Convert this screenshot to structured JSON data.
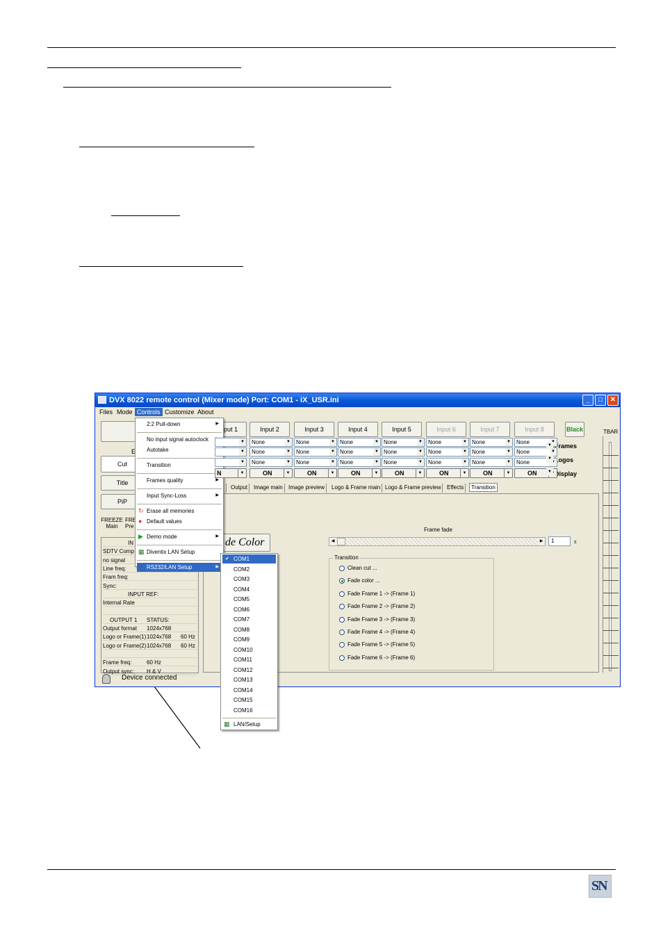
{
  "window": {
    "title": "DVX 8022 remote control     (Mixer mode)  Port: COM1 - iX_USR.ini"
  },
  "menubar": [
    "Files",
    "Mode",
    "Controls",
    "Customize",
    "About"
  ],
  "left_buttons": {
    "letter": "E",
    "cut": "Cut",
    "title": "Title",
    "pip": "PiP",
    "freeze1": "FREEZE",
    "freeze1_sub": "Main",
    "freeze2": "FRE",
    "freeze2_sub": "Pre"
  },
  "inputs": [
    {
      "label": "Input 1",
      "enabled": true
    },
    {
      "label": "Input 2",
      "enabled": true
    },
    {
      "label": "Input 3",
      "enabled": true
    },
    {
      "label": "Input 4",
      "enabled": true
    },
    {
      "label": "Input 5",
      "enabled": true
    },
    {
      "label": "Input 6",
      "enabled": false
    },
    {
      "label": "Input 7",
      "enabled": false
    },
    {
      "label": "Input 8",
      "enabled": false
    }
  ],
  "combo_value": "None",
  "on_label": "ON",
  "partial_labels": {
    "input1": "put 1",
    "on1": "N"
  },
  "black_button": "Black",
  "row_labels": [
    ":Frames",
    ":Logos",
    ":Display"
  ],
  "tbar_label": "TBAR",
  "tabs": [
    "Output",
    "Image main",
    "Image preview",
    "Logo & Frame main",
    "Logo & Frame preview",
    "Effects",
    "Transition"
  ],
  "fade_color_button": "de Color",
  "frame_fade": {
    "label": "Frame fade",
    "value": "1",
    "unit": "s"
  },
  "transition_group": {
    "title": "Transition",
    "options": [
      "Clean cut ...",
      "Fade color ...",
      "Fade Frame 1 -> (Frame 1)",
      "Fade Frame 2 -> (Frame 2)",
      "Fade Frame 3 -> (Frame 3)",
      "Fade Frame 4 -> (Frame 4)",
      "Fade Frame 5 -> (Frame 5)",
      "Fade Frame 6 -> (Frame 6)"
    ],
    "selected": 1
  },
  "status": {
    "rows": [
      {
        "a": "IN",
        "b": ""
      },
      {
        "a": "SDTV Comp",
        "b": ""
      },
      {
        "a": "no signal",
        "b": ""
      },
      {
        "a": "Line freq:",
        "b": ""
      },
      {
        "a": "Fram freq:",
        "b": ""
      },
      {
        "a": "Sync:",
        "b": ""
      },
      {
        "a": "INPUT REF:",
        "b": ""
      },
      {
        "a": "Internal Rate",
        "b": ""
      },
      {
        "a": "",
        "b": ""
      },
      {
        "a": "OUTPUT 1",
        "b": "STATUS:"
      },
      {
        "a": "Output format",
        "b": "1024x768"
      },
      {
        "a": "Logo or Frame(1)",
        "b": "1024x768",
        "c": "60 Hz"
      },
      {
        "a": "Logo or Frame(2)",
        "b": "1024x768",
        "c": "60 Hz"
      },
      {
        "a": "",
        "b": ""
      },
      {
        "a": "Frame freq:",
        "b": "60 Hz"
      },
      {
        "a": "Output sync:",
        "b": "H & V"
      }
    ],
    "connection": "Device connected"
  },
  "controls_menu": [
    {
      "label": "2:2 Pull-down",
      "sub": true
    },
    {
      "sep": true
    },
    {
      "label": "No input signal autoclock",
      "sub": true
    },
    {
      "label": "Autotake",
      "sub": true
    },
    {
      "sep": true
    },
    {
      "label": "Transition",
      "sub": true
    },
    {
      "sep": true
    },
    {
      "label": "Frames quality",
      "sub": true
    },
    {
      "sep": true
    },
    {
      "label": "Input Sync-Loss",
      "sub": true
    },
    {
      "sep": true
    },
    {
      "label": "Erase all memories",
      "icon": "erase"
    },
    {
      "label": "Default values",
      "icon": "default"
    },
    {
      "sep": true
    },
    {
      "label": "Demo mode",
      "sub": true,
      "icon": "play"
    },
    {
      "sep": true
    },
    {
      "label": "Diventix LAN Setup",
      "icon": "lan"
    },
    {
      "sep": true
    },
    {
      "label": "RS232/LAN Setup",
      "sub": true,
      "icon": "plug",
      "selected": true
    }
  ],
  "com_menu": {
    "items": [
      "COM1",
      "COM2",
      "COM3",
      "COM4",
      "COM5",
      "COM6",
      "COM7",
      "COM8",
      "COM9",
      "COM10",
      "COM11",
      "COM12",
      "COM13",
      "COM14",
      "COM15",
      "COM16"
    ],
    "checked": "COM1",
    "footer": "LAN/Setup"
  },
  "logo_text": "SN"
}
